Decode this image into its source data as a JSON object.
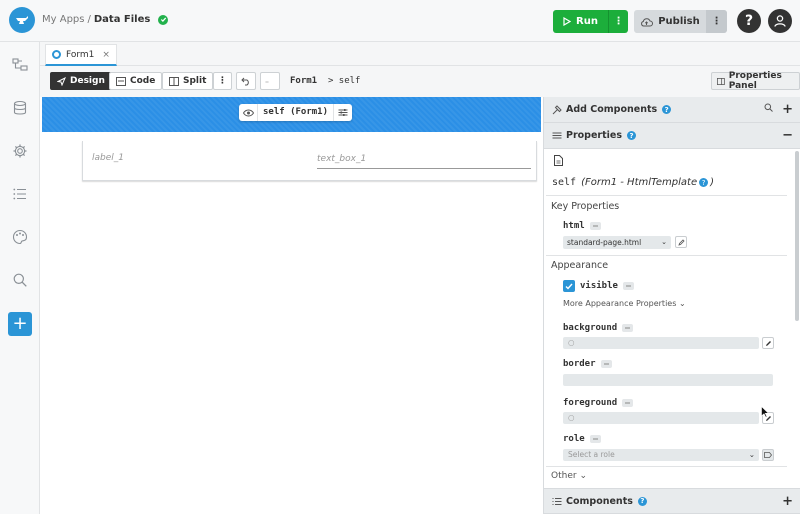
{
  "header": {
    "breadcrumb_apps": "My Apps",
    "breadcrumb_sep": "/",
    "breadcrumb_current": "Data Files",
    "run_label": "Run",
    "publish_label": "Publish",
    "help_label": "?"
  },
  "tab": {
    "label": "Form1",
    "close": "×"
  },
  "toolbar": {
    "design_label": "Design",
    "code_label": "Code",
    "split_label": "Split",
    "more_label": "⋮",
    "path_form": "Form1",
    "path_arrow": ">",
    "path_self": "self",
    "properties_panel_label": "Properties Panel"
  },
  "canvas": {
    "selection_label": "self (Form1)",
    "label_placeholder": "label_1",
    "textbox_placeholder": "text_box_1"
  },
  "panel": {
    "add_components_label": "Add Components",
    "properties_label": "Properties",
    "components_label": "Components",
    "self_mono": "self",
    "self_desc": "(Form1 - HtmlTemplate",
    "self_desc_close": ")",
    "key_properties": "Key Properties",
    "html_label": "html",
    "html_value": "standard-page.html",
    "appearance": "Appearance",
    "visible_label": "visible",
    "more_appearance": "More Appearance Properties",
    "background_label": "background",
    "border_label": "border",
    "foreground_label": "foreground",
    "role_label": "role",
    "role_placeholder": "Select a role",
    "other_label": "Other"
  },
  "colors": {
    "accent": "#2b95d6",
    "run": "#1cae3b",
    "canvas_header": "#2b8fe6"
  }
}
